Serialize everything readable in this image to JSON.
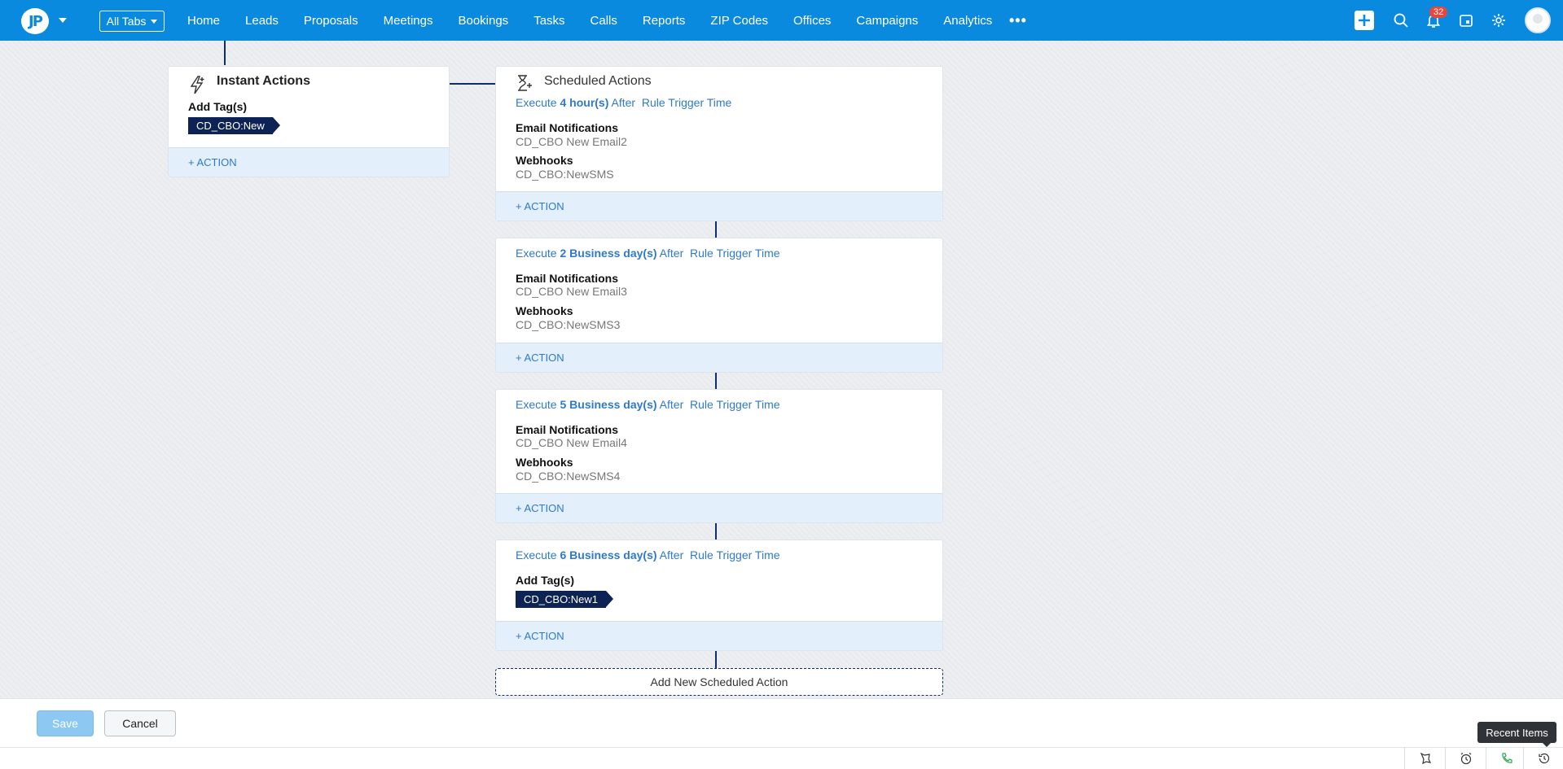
{
  "header": {
    "logo_text": "JP",
    "all_tabs_label": "All Tabs",
    "nav": [
      "Home",
      "Leads",
      "Proposals",
      "Meetings",
      "Bookings",
      "Tasks",
      "Calls",
      "Reports",
      "ZIP Codes",
      "Offices",
      "Campaigns",
      "Analytics"
    ],
    "more_label": "•••",
    "notification_count": "32",
    "icons": [
      "plus-icon",
      "search-icon",
      "bell-icon",
      "calendar-icon",
      "gear-icon",
      "avatar-icon"
    ],
    "accent_color": "#0a8adf"
  },
  "instant": {
    "title": "Instant Actions",
    "label": "Add Tag(s)",
    "tag": "CD_CBO:New",
    "action": "+ ACTION"
  },
  "scheduled": {
    "title": "Scheduled Actions",
    "blocks": [
      {
        "execute": "Execute",
        "amount": "4 hour(s)",
        "after": "After",
        "trigger": "Rule Trigger Time",
        "items": [
          {
            "label": "Email Notifications",
            "value": "CD_CBO New Email2"
          },
          {
            "label": "Webhooks",
            "value": "CD_CBO:NewSMS"
          }
        ],
        "action": "+ ACTION"
      },
      {
        "execute": "Execute",
        "amount": "2 Business day(s)",
        "after": "After",
        "trigger": "Rule Trigger Time",
        "items": [
          {
            "label": "Email Notifications",
            "value": "CD_CBO New Email3"
          },
          {
            "label": "Webhooks",
            "value": "CD_CBO:NewSMS3"
          }
        ],
        "action": "+ ACTION"
      },
      {
        "execute": "Execute",
        "amount": "5 Business day(s)",
        "after": "After",
        "trigger": "Rule Trigger Time",
        "items": [
          {
            "label": "Email Notifications",
            "value": "CD_CBO New Email4"
          },
          {
            "label": "Webhooks",
            "value": "CD_CBO:NewSMS4"
          }
        ],
        "action": "+ ACTION"
      },
      {
        "execute": "Execute",
        "amount": "6 Business day(s)",
        "after": "After",
        "trigger": "Rule Trigger Time",
        "tag_label": "Add Tag(s)",
        "tag": "CD_CBO:New1",
        "action": "+ ACTION"
      }
    ],
    "add_new_label": "Add New Scheduled Action"
  },
  "footer": {
    "save_label": "Save",
    "cancel_label": "Cancel"
  },
  "statusbar": {
    "tooltip": "Recent Items",
    "icons": [
      "crm-feedback-icon",
      "alarm-icon",
      "phone-icon",
      "recent-items-icon"
    ]
  }
}
